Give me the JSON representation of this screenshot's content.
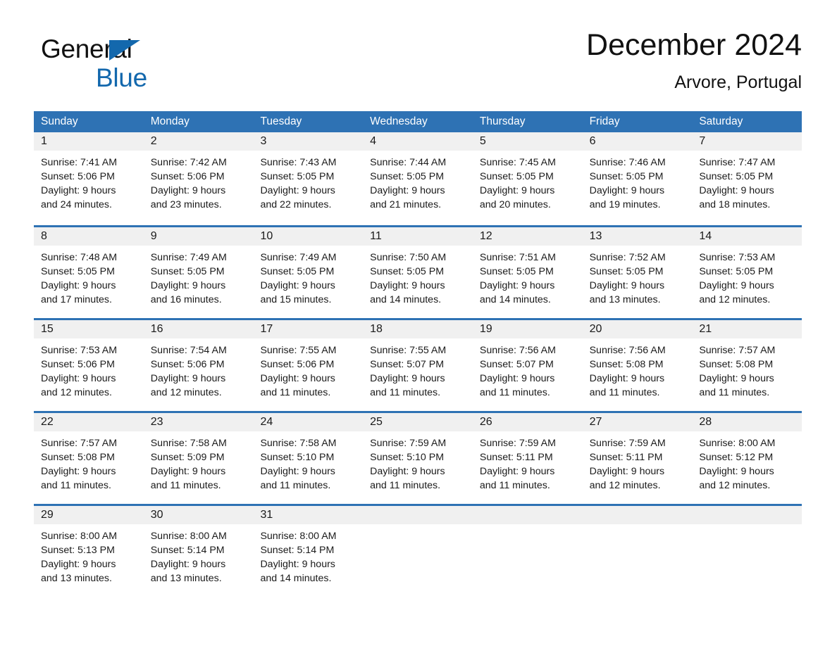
{
  "brand": {
    "name_part1": "General",
    "name_part2": "Blue",
    "triangle_color": "#1368ad"
  },
  "header": {
    "title": "December 2024",
    "location": "Arvore, Portugal"
  },
  "theme": {
    "header_blue": "#2e72b4",
    "row_divider_blue": "#2e72b4",
    "daynum_band": "#f0f0f0",
    "text": "#1a1a1a"
  },
  "weekdays": [
    "Sunday",
    "Monday",
    "Tuesday",
    "Wednesday",
    "Thursday",
    "Friday",
    "Saturday"
  ],
  "weeks": [
    [
      {
        "day": "1",
        "sunrise": "Sunrise: 7:41 AM",
        "sunset": "Sunset: 5:06 PM",
        "daylight1": "Daylight: 9 hours",
        "daylight2": "and 24 minutes."
      },
      {
        "day": "2",
        "sunrise": "Sunrise: 7:42 AM",
        "sunset": "Sunset: 5:06 PM",
        "daylight1": "Daylight: 9 hours",
        "daylight2": "and 23 minutes."
      },
      {
        "day": "3",
        "sunrise": "Sunrise: 7:43 AM",
        "sunset": "Sunset: 5:05 PM",
        "daylight1": "Daylight: 9 hours",
        "daylight2": "and 22 minutes."
      },
      {
        "day": "4",
        "sunrise": "Sunrise: 7:44 AM",
        "sunset": "Sunset: 5:05 PM",
        "daylight1": "Daylight: 9 hours",
        "daylight2": "and 21 minutes."
      },
      {
        "day": "5",
        "sunrise": "Sunrise: 7:45 AM",
        "sunset": "Sunset: 5:05 PM",
        "daylight1": "Daylight: 9 hours",
        "daylight2": "and 20 minutes."
      },
      {
        "day": "6",
        "sunrise": "Sunrise: 7:46 AM",
        "sunset": "Sunset: 5:05 PM",
        "daylight1": "Daylight: 9 hours",
        "daylight2": "and 19 minutes."
      },
      {
        "day": "7",
        "sunrise": "Sunrise: 7:47 AM",
        "sunset": "Sunset: 5:05 PM",
        "daylight1": "Daylight: 9 hours",
        "daylight2": "and 18 minutes."
      }
    ],
    [
      {
        "day": "8",
        "sunrise": "Sunrise: 7:48 AM",
        "sunset": "Sunset: 5:05 PM",
        "daylight1": "Daylight: 9 hours",
        "daylight2": "and 17 minutes."
      },
      {
        "day": "9",
        "sunrise": "Sunrise: 7:49 AM",
        "sunset": "Sunset: 5:05 PM",
        "daylight1": "Daylight: 9 hours",
        "daylight2": "and 16 minutes."
      },
      {
        "day": "10",
        "sunrise": "Sunrise: 7:49 AM",
        "sunset": "Sunset: 5:05 PM",
        "daylight1": "Daylight: 9 hours",
        "daylight2": "and 15 minutes."
      },
      {
        "day": "11",
        "sunrise": "Sunrise: 7:50 AM",
        "sunset": "Sunset: 5:05 PM",
        "daylight1": "Daylight: 9 hours",
        "daylight2": "and 14 minutes."
      },
      {
        "day": "12",
        "sunrise": "Sunrise: 7:51 AM",
        "sunset": "Sunset: 5:05 PM",
        "daylight1": "Daylight: 9 hours",
        "daylight2": "and 14 minutes."
      },
      {
        "day": "13",
        "sunrise": "Sunrise: 7:52 AM",
        "sunset": "Sunset: 5:05 PM",
        "daylight1": "Daylight: 9 hours",
        "daylight2": "and 13 minutes."
      },
      {
        "day": "14",
        "sunrise": "Sunrise: 7:53 AM",
        "sunset": "Sunset: 5:05 PM",
        "daylight1": "Daylight: 9 hours",
        "daylight2": "and 12 minutes."
      }
    ],
    [
      {
        "day": "15",
        "sunrise": "Sunrise: 7:53 AM",
        "sunset": "Sunset: 5:06 PM",
        "daylight1": "Daylight: 9 hours",
        "daylight2": "and 12 minutes."
      },
      {
        "day": "16",
        "sunrise": "Sunrise: 7:54 AM",
        "sunset": "Sunset: 5:06 PM",
        "daylight1": "Daylight: 9 hours",
        "daylight2": "and 12 minutes."
      },
      {
        "day": "17",
        "sunrise": "Sunrise: 7:55 AM",
        "sunset": "Sunset: 5:06 PM",
        "daylight1": "Daylight: 9 hours",
        "daylight2": "and 11 minutes."
      },
      {
        "day": "18",
        "sunrise": "Sunrise: 7:55 AM",
        "sunset": "Sunset: 5:07 PM",
        "daylight1": "Daylight: 9 hours",
        "daylight2": "and 11 minutes."
      },
      {
        "day": "19",
        "sunrise": "Sunrise: 7:56 AM",
        "sunset": "Sunset: 5:07 PM",
        "daylight1": "Daylight: 9 hours",
        "daylight2": "and 11 minutes."
      },
      {
        "day": "20",
        "sunrise": "Sunrise: 7:56 AM",
        "sunset": "Sunset: 5:08 PM",
        "daylight1": "Daylight: 9 hours",
        "daylight2": "and 11 minutes."
      },
      {
        "day": "21",
        "sunrise": "Sunrise: 7:57 AM",
        "sunset": "Sunset: 5:08 PM",
        "daylight1": "Daylight: 9 hours",
        "daylight2": "and 11 minutes."
      }
    ],
    [
      {
        "day": "22",
        "sunrise": "Sunrise: 7:57 AM",
        "sunset": "Sunset: 5:08 PM",
        "daylight1": "Daylight: 9 hours",
        "daylight2": "and 11 minutes."
      },
      {
        "day": "23",
        "sunrise": "Sunrise: 7:58 AM",
        "sunset": "Sunset: 5:09 PM",
        "daylight1": "Daylight: 9 hours",
        "daylight2": "and 11 minutes."
      },
      {
        "day": "24",
        "sunrise": "Sunrise: 7:58 AM",
        "sunset": "Sunset: 5:10 PM",
        "daylight1": "Daylight: 9 hours",
        "daylight2": "and 11 minutes."
      },
      {
        "day": "25",
        "sunrise": "Sunrise: 7:59 AM",
        "sunset": "Sunset: 5:10 PM",
        "daylight1": "Daylight: 9 hours",
        "daylight2": "and 11 minutes."
      },
      {
        "day": "26",
        "sunrise": "Sunrise: 7:59 AM",
        "sunset": "Sunset: 5:11 PM",
        "daylight1": "Daylight: 9 hours",
        "daylight2": "and 11 minutes."
      },
      {
        "day": "27",
        "sunrise": "Sunrise: 7:59 AM",
        "sunset": "Sunset: 5:11 PM",
        "daylight1": "Daylight: 9 hours",
        "daylight2": "and 12 minutes."
      },
      {
        "day": "28",
        "sunrise": "Sunrise: 8:00 AM",
        "sunset": "Sunset: 5:12 PM",
        "daylight1": "Daylight: 9 hours",
        "daylight2": "and 12 minutes."
      }
    ],
    [
      {
        "day": "29",
        "sunrise": "Sunrise: 8:00 AM",
        "sunset": "Sunset: 5:13 PM",
        "daylight1": "Daylight: 9 hours",
        "daylight2": "and 13 minutes."
      },
      {
        "day": "30",
        "sunrise": "Sunrise: 8:00 AM",
        "sunset": "Sunset: 5:14 PM",
        "daylight1": "Daylight: 9 hours",
        "daylight2": "and 13 minutes."
      },
      {
        "day": "31",
        "sunrise": "Sunrise: 8:00 AM",
        "sunset": "Sunset: 5:14 PM",
        "daylight1": "Daylight: 9 hours",
        "daylight2": "and 14 minutes."
      },
      {
        "day": "",
        "sunrise": "",
        "sunset": "",
        "daylight1": "",
        "daylight2": ""
      },
      {
        "day": "",
        "sunrise": "",
        "sunset": "",
        "daylight1": "",
        "daylight2": ""
      },
      {
        "day": "",
        "sunrise": "",
        "sunset": "",
        "daylight1": "",
        "daylight2": ""
      },
      {
        "day": "",
        "sunrise": "",
        "sunset": "",
        "daylight1": "",
        "daylight2": ""
      }
    ]
  ]
}
